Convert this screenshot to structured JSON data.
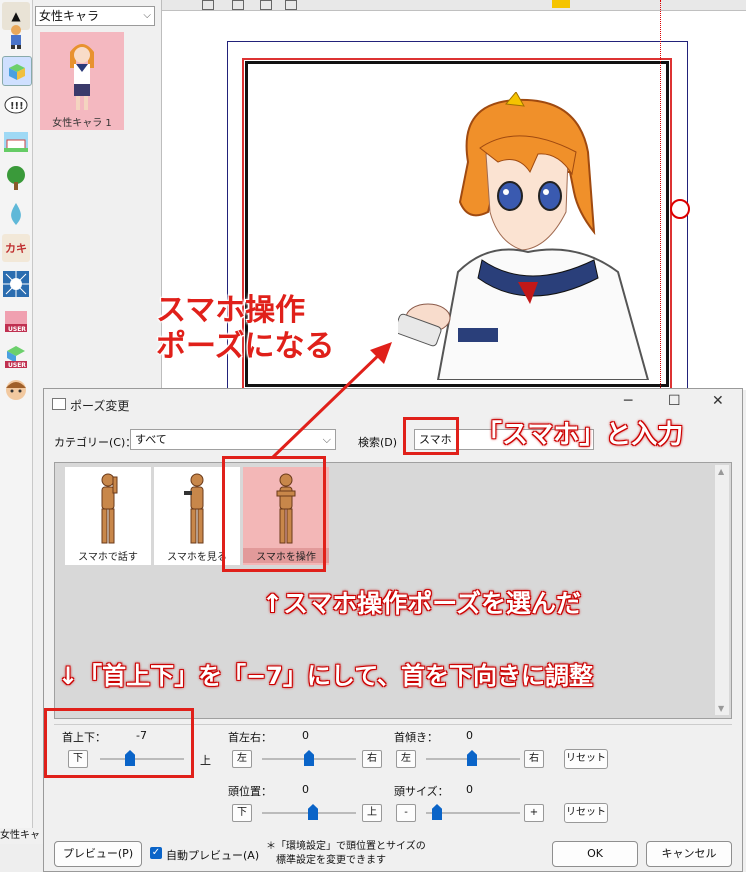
{
  "char_panel": {
    "select_value": "女性キャラ",
    "thumbnail_label": "女性キャラ 1"
  },
  "footer_tab": "女性キャ",
  "dialog": {
    "title": "ポーズ変更",
    "category_label": "カテゴリー(C)：",
    "category_value": "すべて",
    "search_label": "検索(D)",
    "search_value": "スマホ",
    "poses": [
      {
        "label": "スマホで話す",
        "selected": false
      },
      {
        "label": "スマホを見る",
        "selected": false
      },
      {
        "label": "スマホを操作",
        "selected": true
      }
    ],
    "controls": {
      "neck_updown": {
        "label": "首上下：",
        "value": "-7",
        "minus": "下",
        "plus": "上"
      },
      "neck_lr": {
        "label": "首左右：",
        "value": "0",
        "minus": "左",
        "plus": "右"
      },
      "neck_tilt": {
        "label": "首傾き：",
        "value": "0",
        "minus": "左",
        "plus": "右"
      },
      "head_pos": {
        "label": "頭位置：",
        "value": "0",
        "minus": "下",
        "plus": "上"
      },
      "head_size": {
        "label": "頭サイズ：",
        "value": "0",
        "minus": "-",
        "plus": "+"
      },
      "reset": "リセット"
    },
    "preview_button": "プレビュー(P)",
    "auto_preview_label": "自動プレビュー(A)",
    "note_line1": "＊「環境設定」で頭位置とサイズの",
    "note_line2": "標準設定を変更できます",
    "ok_button": "OK",
    "cancel_button": "キャンセル"
  },
  "annotations": {
    "result_line1": "スマホ操作",
    "result_line2": "ポーズになる",
    "search_hint": "「スマホ」と入力",
    "pose_hint": "↑スマホ操作ポーズを選んだ",
    "neck_hint": "↓「首上下」を「−7」にして、首を下向きに調整"
  },
  "colors": {
    "annotation_red": "#e0201a",
    "slider_blue": "#0a64c8"
  }
}
